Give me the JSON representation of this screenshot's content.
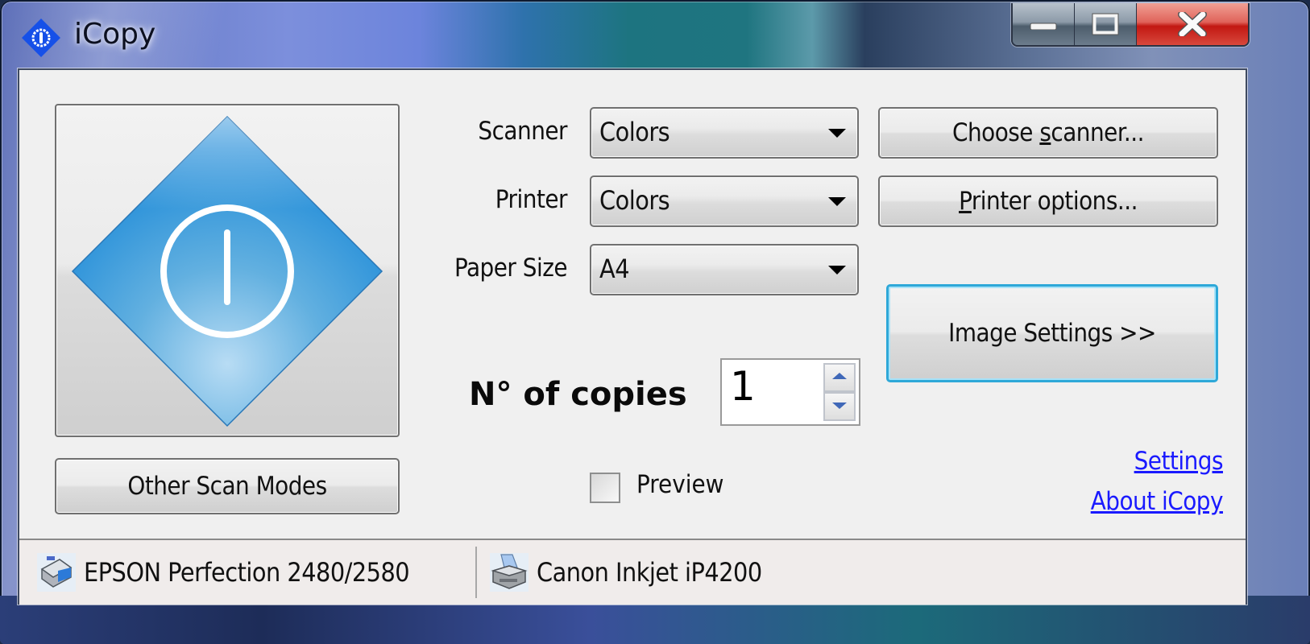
{
  "window": {
    "title": "iCopy",
    "caption_buttons": [
      "minimize",
      "maximize",
      "close"
    ]
  },
  "main": {
    "scan_button_icon": "power-diamond-icon",
    "other_scan_modes_label": "Other Scan Modes",
    "scanner": {
      "label": "Scanner",
      "value": "Colors"
    },
    "printer": {
      "label": "Printer",
      "value": "Colors"
    },
    "paper_size": {
      "label": "Paper Size",
      "value": "A4"
    },
    "choose_scanner": {
      "pre": "Choose ",
      "accel": "s",
      "post": "canner..."
    },
    "printer_options": {
      "pre": "",
      "accel": "P",
      "post": "rinter options..."
    },
    "image_settings_label": "Image Settings >>",
    "copies": {
      "label": "N° of copies",
      "value": "1"
    },
    "preview": {
      "label": "Preview",
      "checked": false
    },
    "links": {
      "settings": "Settings",
      "about": "About iCopy"
    },
    "link_color": "#1a1aff",
    "focus_color": "#2ea8d8"
  },
  "statusbar": {
    "scanner": {
      "icon": "scanner-icon",
      "name": "EPSON Perfection 2480/2580"
    },
    "printer": {
      "icon": "printer-icon",
      "name": "Canon Inkjet iP4200"
    }
  }
}
